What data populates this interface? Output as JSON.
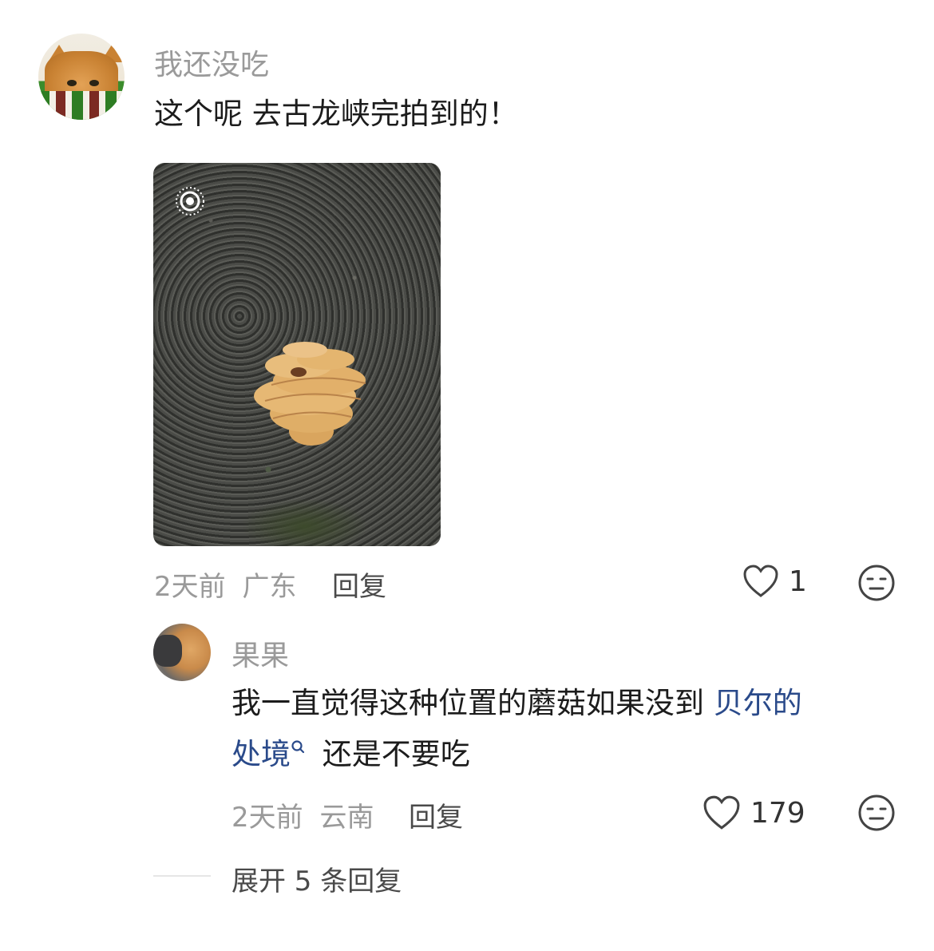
{
  "comment1": {
    "username": "我还没吃",
    "text": "这个呢 去古龙峡完拍到的！",
    "photo_icon": "live-photo-icon",
    "time": "2天前",
    "location": "广东",
    "reply_label": "回复",
    "like_count": "1"
  },
  "comment2": {
    "username": "果果",
    "text_line1_plain": "我一直觉得这种位置的蘑菇如果没到",
    "text_link_part1": "贝尔的",
    "text_link_part2": "处境",
    "text_line2_rest": "还是不要吃",
    "time": "2天前",
    "location": "云南",
    "reply_label": "回复",
    "like_count": "179"
  },
  "expand_replies": "展开 5 条回复",
  "icons": {
    "like": "heart-outline-icon",
    "dislike": "neutral-face-icon",
    "search": "search-icon"
  },
  "colors": {
    "link": "#2a4a8a",
    "meta": "#9a9a9a"
  }
}
